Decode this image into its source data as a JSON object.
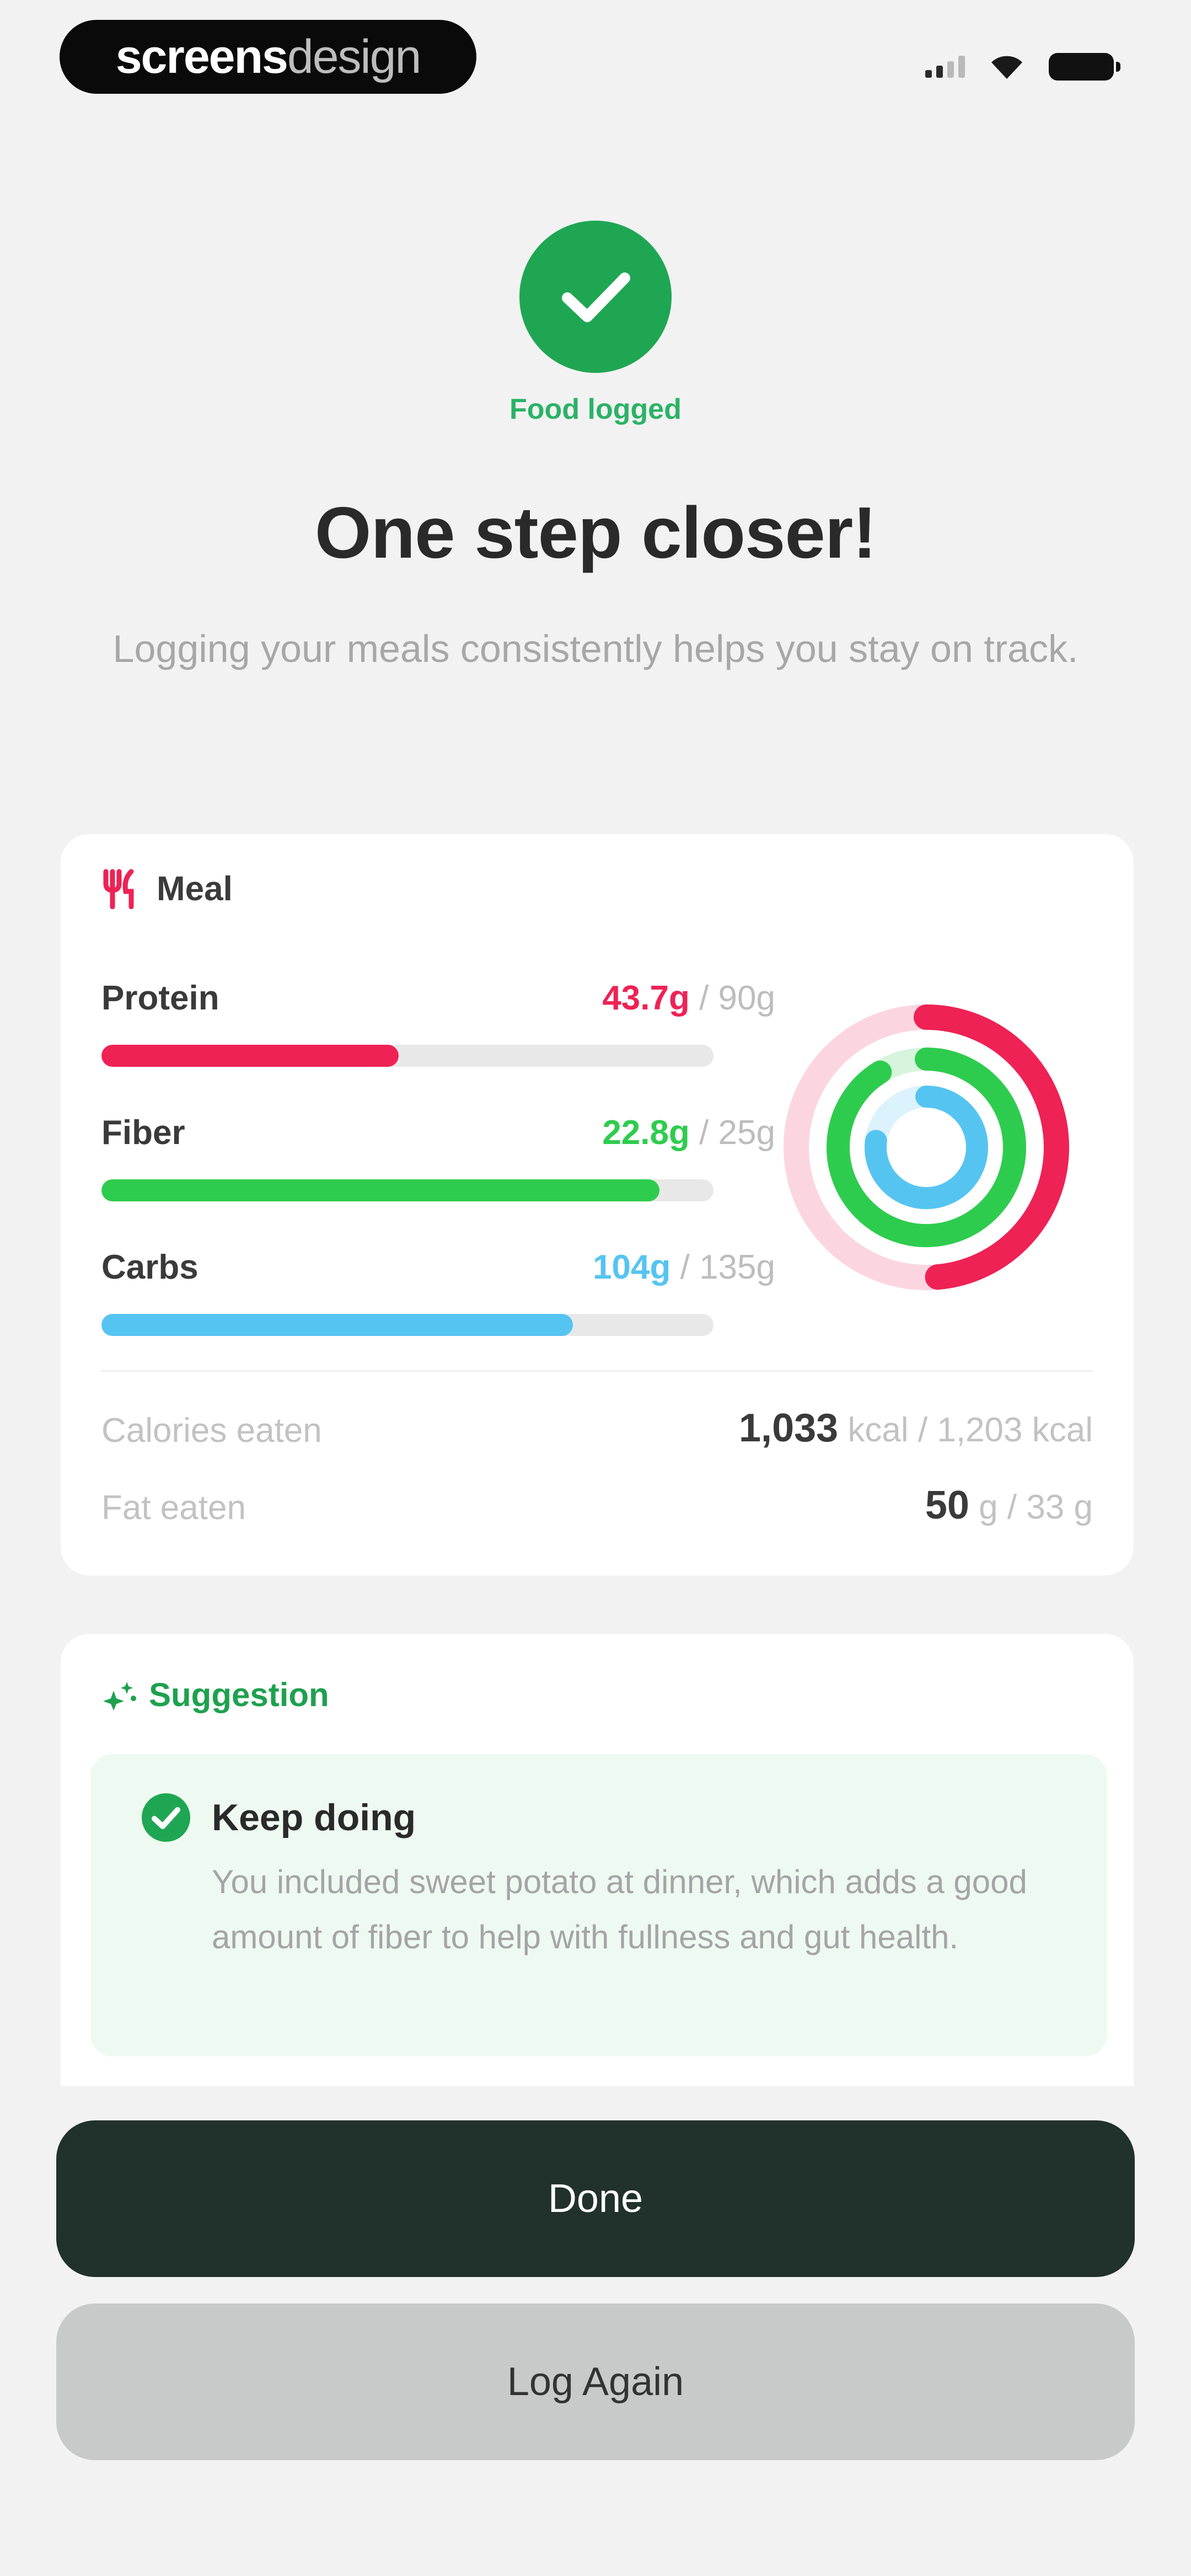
{
  "status_bar": {
    "brand_bold": "screens",
    "brand_light": "design",
    "icons": [
      "cellular-signal-icon",
      "wifi-icon",
      "battery-icon"
    ]
  },
  "hero": {
    "icon": "checkmark-icon",
    "status_label": "Food logged",
    "title": "One step closer!",
    "subtitle": "Logging your meals consistently helps you stay on track."
  },
  "meal_card": {
    "icon": "fork-knife-icon",
    "title": "Meal",
    "nutrients": [
      {
        "name": "Protein",
        "value": "43.7g",
        "goal": " / 90g",
        "progress": 0.486,
        "color": "#ee2255"
      },
      {
        "name": "Fiber",
        "value": "22.8g",
        "goal": " / 25g",
        "progress": 0.912,
        "color": "#2ecc4e"
      },
      {
        "name": "Carbs",
        "value": "104g",
        "goal": " / 135g",
        "progress": 0.77,
        "color": "#56c4f1"
      }
    ],
    "stats": [
      {
        "label": "Calories eaten",
        "value": "1,033",
        "unit": " kcal / 1,203 kcal"
      },
      {
        "label": "Fat eaten",
        "value": "50",
        "unit": " g / 33 g"
      }
    ]
  },
  "suggestion": {
    "icon": "sparkle-icon",
    "title": "Suggestion",
    "tip_icon": "check-circle-icon",
    "tip_title": "Keep doing",
    "tip_body": "You included sweet potato at dinner, which adds a good amount of fiber to help with fullness and gut health."
  },
  "actions": {
    "done_label": "Done",
    "log_again_label": "Log Again"
  },
  "colors": {
    "accent_green": "#1fa653",
    "protein": "#ee2255",
    "fiber": "#2ecc4e",
    "carbs": "#56c4f1",
    "primary_button": "#21312b"
  }
}
